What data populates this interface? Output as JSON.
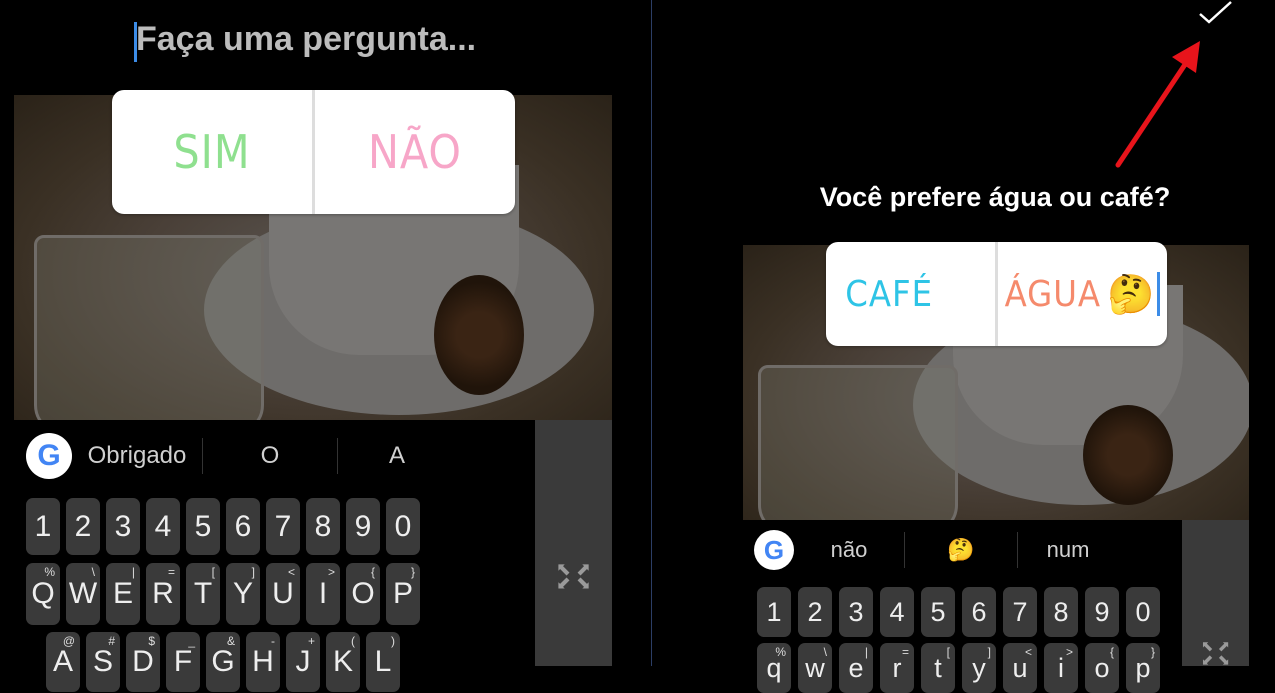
{
  "left": {
    "question_placeholder": "Faça uma pergunta...",
    "poll": {
      "yes": "SIM",
      "no": "NÃO",
      "yes_color": "#8fe08f",
      "no_color": "#f7a6c8"
    },
    "keyboard": {
      "suggestions": [
        "Obrigado",
        "O",
        "A"
      ],
      "numbers": [
        "1",
        "2",
        "3",
        "4",
        "5",
        "6",
        "7",
        "8",
        "9",
        "0"
      ],
      "row1": [
        "Q",
        "W",
        "E",
        "R",
        "T",
        "Y",
        "U",
        "I",
        "O",
        "P"
      ],
      "row1_alt": [
        "%",
        "\\",
        "|",
        "=",
        "[",
        "]",
        "<",
        ">",
        "{",
        "}"
      ],
      "row2": [
        "A",
        "S",
        "D",
        "F",
        "G",
        "H",
        "J",
        "K",
        "L"
      ],
      "row2_alt": [
        "@",
        "#",
        "$",
        "_",
        "&",
        "-",
        "+",
        "(",
        ")"
      ]
    }
  },
  "right": {
    "confirm_icon": "check-icon",
    "annotation_color": "#e8141b",
    "question": "Você prefere água ou café?",
    "poll": {
      "option1": "CAFÉ",
      "option1_emoji": "😍",
      "option2": "ÁGUA",
      "option2_emoji": "🤔",
      "option1_color": "#2ec4e6",
      "option2_color": "#f58a6c"
    },
    "keyboard": {
      "suggestions": [
        "não",
        "🤔",
        "num"
      ],
      "numbers": [
        "1",
        "2",
        "3",
        "4",
        "5",
        "6",
        "7",
        "8",
        "9",
        "0"
      ],
      "row1": [
        "q",
        "w",
        "e",
        "r",
        "t",
        "y",
        "u",
        "i",
        "o",
        "p"
      ],
      "row1_alt": [
        "%",
        "\\",
        "|",
        "=",
        "[",
        "]",
        "<",
        ">",
        "{",
        "}"
      ]
    }
  }
}
